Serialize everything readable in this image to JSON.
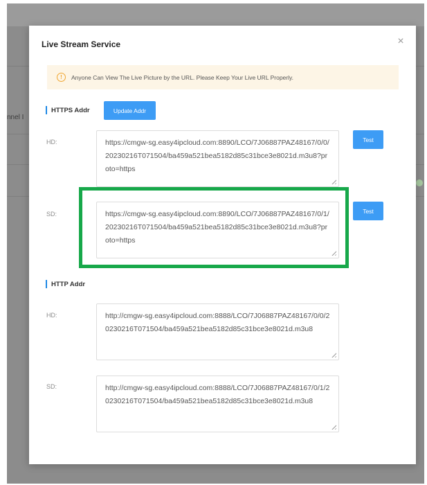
{
  "background": {
    "truncated_text": "nnel I"
  },
  "dialog": {
    "title": "Live Stream Service",
    "close_icon": "close-icon",
    "notice": {
      "icon": "warning-circle-icon",
      "text": "Anyone Can View The Live Picture by the URL. Please Keep Your Live URL Properly."
    },
    "https": {
      "section_label": "HTTPS Addr",
      "update_button": "Update Addr",
      "hd": {
        "label": "HD:",
        "url": "https://cmgw-sg.easy4ipcloud.com:8890/LCO/7J06887PAZ48167/0/0/20230216T071504/ba459a521bea5182d85c31bce3e8021d.m3u8?proto=https",
        "test_button": "Test"
      },
      "sd": {
        "label": "SD:",
        "url": "https://cmgw-sg.easy4ipcloud.com:8890/LCO/7J06887PAZ48167/0/1/20230216T071504/ba459a521bea5182d85c31bce3e8021d.m3u8?proto=https",
        "test_button": "Test"
      }
    },
    "http": {
      "section_label": "HTTP Addr",
      "hd": {
        "label": "HD:",
        "url": "http://cmgw-sg.easy4ipcloud.com:8888/LCO/7J06887PAZ48167/0/0/20230216T071504/ba459a521bea5182d85c31bce3e8021d.m3u8"
      },
      "sd": {
        "label": "SD:",
        "url": "http://cmgw-sg.easy4ipcloud.com:8888/LCO/7J06887PAZ48167/0/1/20230216T071504/ba459a521bea5182d85c31bce3e8021d.m3u8"
      }
    }
  },
  "colors": {
    "accent": "#3d9cf5",
    "highlight": "#17a84a",
    "notice_bg": "#fdf5e6",
    "warning": "#f0a530"
  }
}
